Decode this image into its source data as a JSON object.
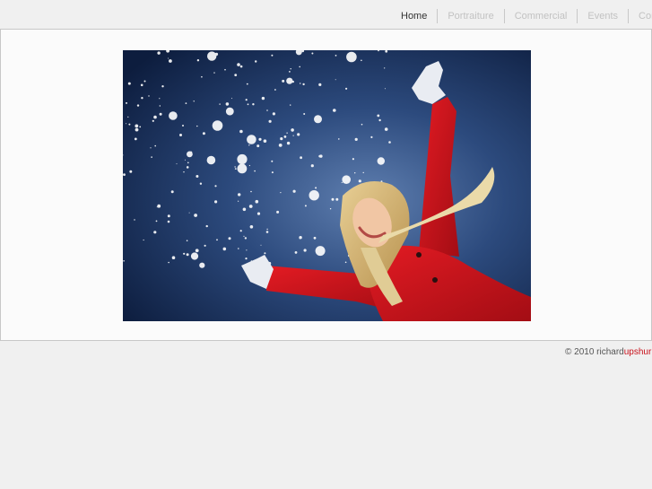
{
  "nav": {
    "items": [
      {
        "label": "Home",
        "active": true
      },
      {
        "label": "Portraiture",
        "active": false
      },
      {
        "label": "Commercial",
        "active": false
      },
      {
        "label": "Events",
        "active": false
      },
      {
        "label": "Contact",
        "active": false
      }
    ]
  },
  "footer": {
    "prefix": "© 2010 richard",
    "accent": "upshur"
  },
  "colors": {
    "background": "#f0f0f0",
    "nav_active": "#333333",
    "nav_inactive": "#c2c2c2",
    "brand_accent": "#c8101a"
  }
}
